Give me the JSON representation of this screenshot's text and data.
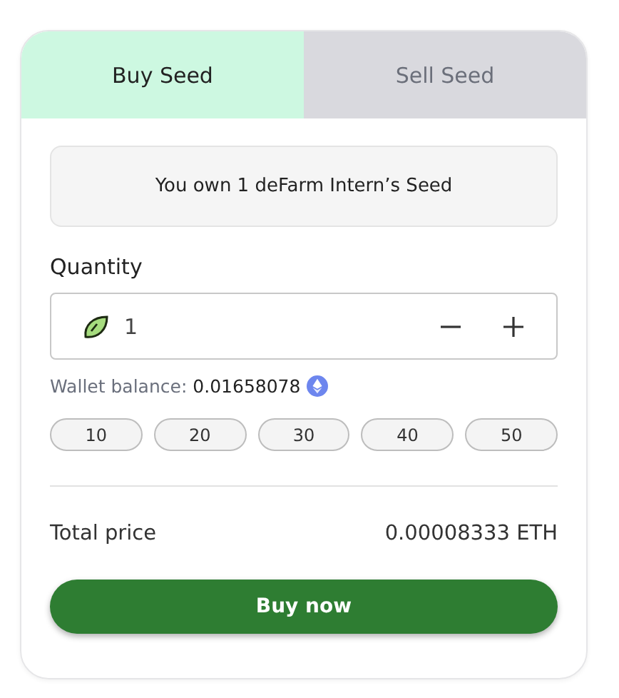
{
  "tabs": [
    {
      "label": "Buy Seed",
      "selected": true
    },
    {
      "label": "Sell Seed",
      "selected": false
    }
  ],
  "notice": "You own 1 deFarm Intern’s Seed",
  "quantity": {
    "label": "Quantity",
    "value": "1"
  },
  "wallet": {
    "label": "Wallet balance:",
    "value": "0.01658078"
  },
  "presets": [
    "10",
    "20",
    "30",
    "40",
    "50"
  ],
  "total": {
    "label": "Total price",
    "value": "0.00008333 ETH"
  },
  "button": "Buy now"
}
